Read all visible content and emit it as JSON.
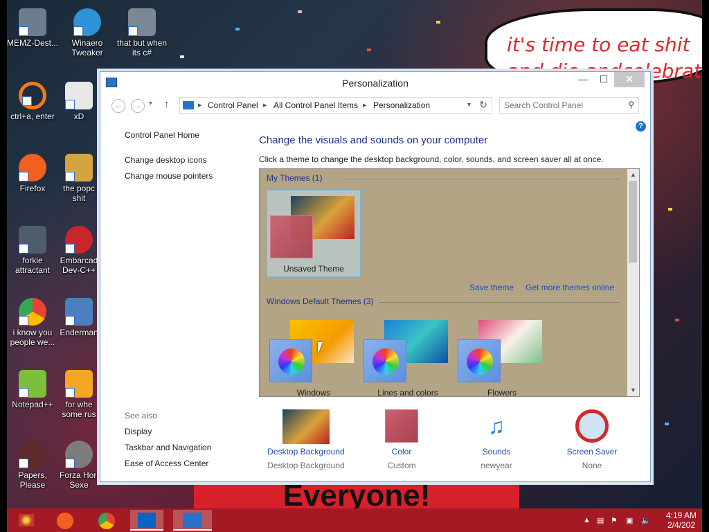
{
  "bubble_text": [
    "it's time to eat shit",
    "and die andcelebrate"
  ],
  "banner_text": "Everyone!",
  "desktop_icons": [
    {
      "label": "MEMZ-Dest...",
      "icon": "recycle-bin-icon",
      "color": "#6c7d8e"
    },
    {
      "label": "Winaero Tweaker",
      "icon": "winaero-icon",
      "color": "#2f92d6"
    },
    {
      "label": "that but when its c#",
      "icon": "windows-stack-icon",
      "color": "#7b8794"
    },
    {
      "label": "ctrl+a, enter",
      "icon": "orange-ring-icon",
      "color": "#f07c18"
    },
    {
      "label": "xD",
      "icon": "xd-icon",
      "color": "#e8e8e8"
    },
    {
      "label": "Firefox",
      "icon": "firefox-icon",
      "color": "#f2601f"
    },
    {
      "label": "the popc shit",
      "icon": "image-file-icon",
      "color": "#d4a441"
    },
    {
      "label": "forkie attractant",
      "icon": "gears-icon",
      "color": "#4e5d6c"
    },
    {
      "label": "Embarcad Dev-C++",
      "icon": "devcpp-icon",
      "color": "#c9262c"
    },
    {
      "label": "i know you people we...",
      "icon": "chrome-icon",
      "color": "#33a852"
    },
    {
      "label": "Enderman",
      "icon": "enderman-icon",
      "color": "#4c7fbf"
    },
    {
      "label": "Notepad++",
      "icon": "notepadpp-icon",
      "color": "#7bbf3a"
    },
    {
      "label": "for whe some rus",
      "icon": "de-icon",
      "color": "#f5a623"
    },
    {
      "label": "Papers, Please",
      "icon": "papers-please-icon",
      "color": "#5e2a2a"
    },
    {
      "label": "Forza Hori Sexe",
      "icon": "flash-icon",
      "color": "#7c7c7c"
    }
  ],
  "window": {
    "title": "Personalization",
    "address": [
      "Control Panel",
      "All Control Panel Items",
      "Personalization"
    ],
    "search_placeholder": "Search Control Panel",
    "left_links": [
      "Control Panel Home",
      "Change desktop icons",
      "Change mouse pointers"
    ],
    "see_also_label": "See also",
    "see_also": [
      "Display",
      "Taskbar and Navigation",
      "Ease of Access Center"
    ],
    "heading": "Change the visuals and sounds on your computer",
    "subheading": "Click a theme to change the desktop background, color, sounds, and screen saver all at once.",
    "my_themes_label": "My Themes (1)",
    "unsaved_theme": "Unsaved Theme",
    "save_theme": "Save theme",
    "get_more": "Get more themes online",
    "default_themes_label": "Windows Default Themes (3)",
    "default_themes": [
      "Windows",
      "Lines and colors",
      "Flowers"
    ],
    "bottom": [
      {
        "label": "Desktop Background",
        "value": "Desktop Background"
      },
      {
        "label": "Color",
        "value": "Custom"
      },
      {
        "label": "Sounds",
        "value": "newyear"
      },
      {
        "label": "Screen Saver",
        "value": "None"
      }
    ]
  },
  "taskbar": {
    "time": "4:19 AM",
    "date": "2/4/202"
  },
  "colors": {
    "theme_bg": "#b3a486",
    "taskbar": "#a41a24",
    "link": "#1e4db5",
    "heading": "#1e3287"
  }
}
